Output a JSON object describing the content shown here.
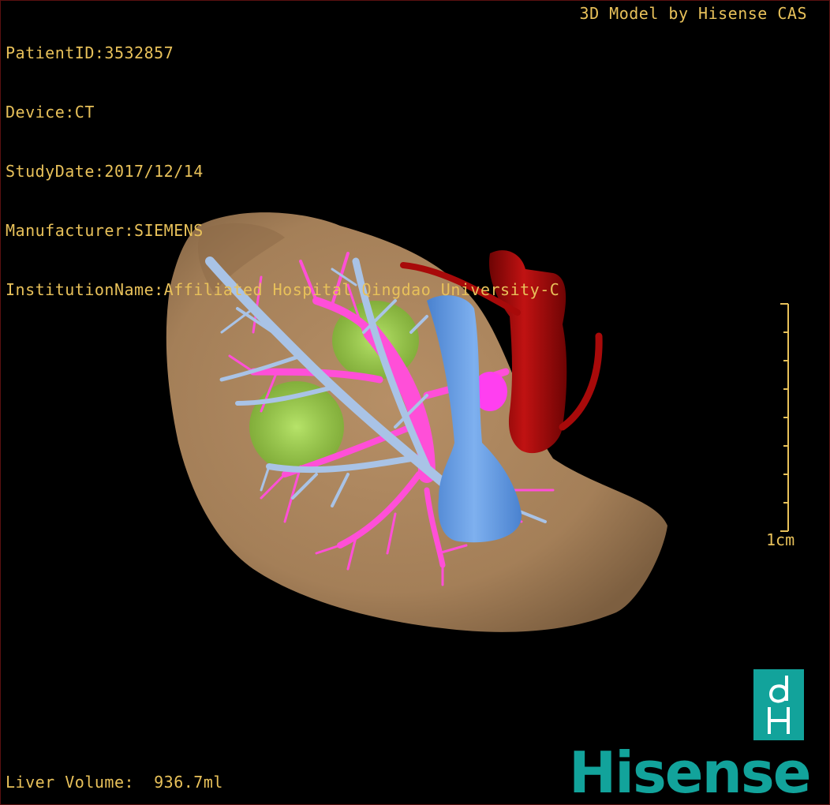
{
  "header": {
    "patient_id": "PatientID:3532857",
    "device": "Device:CT",
    "study_date": "StudyDate:2017/12/14",
    "manufacturer": "Manufacturer:SIEMENS",
    "institution": "InstitutionName:Affiliated Hospital Qingdao University-C"
  },
  "credit": "3D Model by Hisense CAS",
  "scale": {
    "label": "1cm"
  },
  "footer": {
    "liver_volume": "Liver Volume:  936.7ml"
  },
  "logo": {
    "brand": "Hisense",
    "mark_icon": "hisense-dh-logo-icon"
  },
  "colors": {
    "overlay_text": "#e8c15a",
    "liver": "#a47f58",
    "portal_vein": "#ff4fd8",
    "hepatic_vein": "#a9c3e6",
    "ivc": "#5a97e3",
    "artery": "#a80a0a",
    "lesion": "#8fd63a",
    "brand": "#12a39b"
  }
}
